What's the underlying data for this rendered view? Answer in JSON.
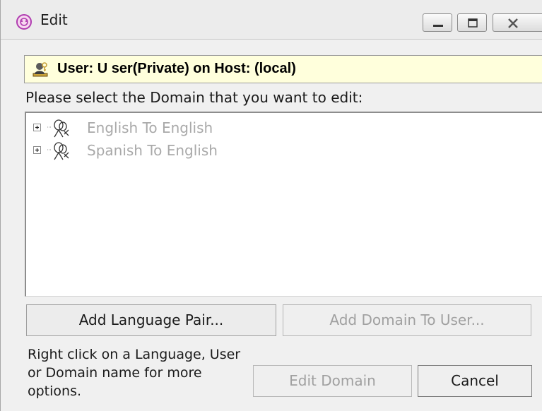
{
  "window": {
    "title": "Edit",
    "caption_buttons": [
      "minimize",
      "maximize",
      "close"
    ]
  },
  "banner": {
    "text": "User: U ser(Private) on Host: (local)",
    "background": "#ffffdc",
    "icon": "user-key-icon"
  },
  "prompt": "Please select the Domain that you want to edit:",
  "tree": {
    "items": [
      {
        "label": "English To English",
        "icon": "domain-people-icon",
        "expander": "plus"
      },
      {
        "label": "Spanish To English",
        "icon": "domain-people-icon",
        "expander": "plus"
      }
    ],
    "item_text_color": "#a9a9a9"
  },
  "buttons": {
    "add_language_pair": "Add Language Pair...",
    "add_domain_to_user": "Add Domain To User...",
    "edit_domain": "Edit Domain",
    "cancel": "Cancel"
  },
  "hint": "Right click on a Language, User or Domain name for more options."
}
